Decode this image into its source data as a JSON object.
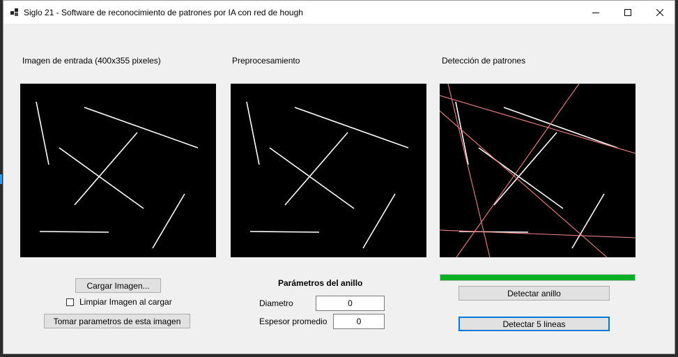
{
  "window": {
    "title": "Siglo 21 - Software de reconocimiento de patrones por IA con red de hough"
  },
  "panels": {
    "input_label": "Imagen de entrada (400x355 pixeles)",
    "preprocess_label": "Preprocesamiento",
    "detection_label": "Detección de patrones"
  },
  "controls": {
    "load_button": "Cargar Imagen...",
    "clear_checkbox_label": "Limpiar Imagen al cargar",
    "clear_checkbox_checked": false,
    "take_params_button": "Tomar parametros de esta imagen"
  },
  "ring_params": {
    "heading": "Parámetros del anillo",
    "diameter_label": "Diametro",
    "diameter_value": "0",
    "thickness_label": "Espesor promedio",
    "thickness_value": "0"
  },
  "detection": {
    "progress_percent": 100,
    "progress_color": "#06b025",
    "detect_ring_button": "Detectar anillo",
    "detect_lines_button": "Detectar 5  lineas"
  },
  "colors": {
    "detected_line": "#f08080",
    "segment": "#ffffff"
  }
}
